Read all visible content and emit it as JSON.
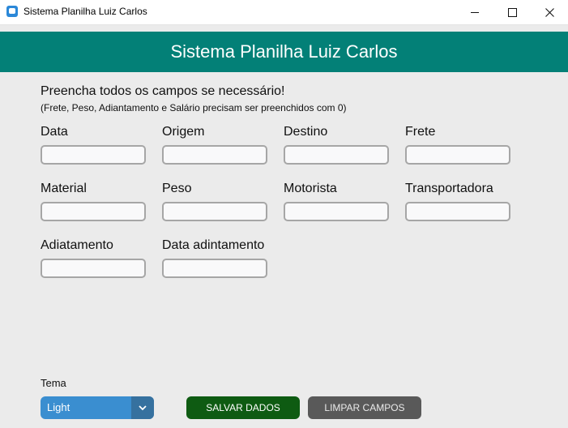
{
  "window": {
    "title": "Sistema Planilha Luiz Carlos"
  },
  "banner": {
    "title": "Sistema Planilha Luiz Carlos"
  },
  "instructions": {
    "main": "Preencha todos os campos se necessário!",
    "note": "(Frete, Peso, Adiantamento e Salário precisam ser preenchidos com 0)"
  },
  "fields": [
    {
      "label": "Data",
      "value": ""
    },
    {
      "label": "Origem",
      "value": ""
    },
    {
      "label": "Destino",
      "value": ""
    },
    {
      "label": "Frete",
      "value": ""
    },
    {
      "label": "Material",
      "value": ""
    },
    {
      "label": "Peso",
      "value": ""
    },
    {
      "label": "Motorista",
      "value": ""
    },
    {
      "label": "Transportadora",
      "value": ""
    },
    {
      "label": "Adiatamento",
      "value": ""
    },
    {
      "label": "Data adintamento",
      "value": ""
    }
  ],
  "theme": {
    "label": "Tema",
    "selected": "Light"
  },
  "buttons": {
    "save": "SALVAR DADOS",
    "clear": "LIMPAR CAMPOS"
  },
  "colors": {
    "banner": "#038077",
    "save_button": "#0e5b12",
    "clear_button": "#595959",
    "theme_select": "#3a8ed0"
  }
}
